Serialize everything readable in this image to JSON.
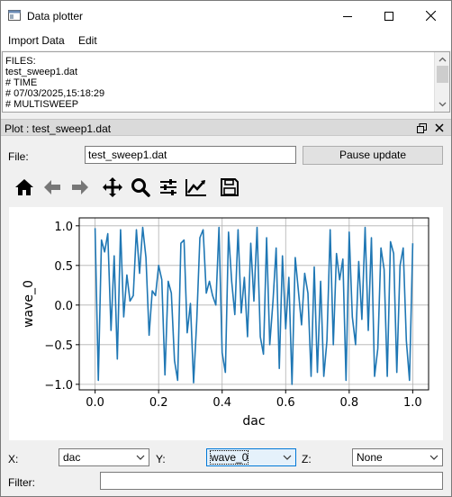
{
  "window": {
    "title": "Data plotter"
  },
  "menu": {
    "items": [
      "Import Data",
      "Edit"
    ]
  },
  "files_box": {
    "lines": [
      "FILES:",
      "test_sweep1.dat",
      "# TIME",
      "# 07/03/2025,15:18:29",
      "# MULTISWEEP"
    ]
  },
  "dock": {
    "title": "Plot : test_sweep1.dat"
  },
  "file_row": {
    "label": "File:",
    "value": "test_sweep1.dat",
    "pause_label": "Pause update"
  },
  "toolbar": {
    "icons": [
      "home-icon",
      "back-arrow-icon",
      "forward-arrow-icon",
      "pan-icon",
      "zoom-icon",
      "configure-subplots-icon",
      "edit-axis-icon",
      "save-icon"
    ]
  },
  "selectors": {
    "x_label": "X:",
    "x_value": "dac",
    "y_label": "Y:",
    "y_value": "wave_0",
    "z_label": "Z:",
    "z_value": "None",
    "filter_label": "Filter:",
    "filter_value": ""
  },
  "colors": {
    "line": "#1f77b4",
    "accent": "#0078d7"
  },
  "chart_data": {
    "type": "line",
    "xlabel": "dac",
    "ylabel": "wave_0",
    "xlim": [
      -0.05,
      1.05
    ],
    "ylim": [
      -1.07,
      1.1
    ],
    "xticks": [
      "0.0",
      "0.2",
      "0.4",
      "0.6",
      "0.8",
      "1.0"
    ],
    "yticks": [
      "1.0",
      "0.5",
      "0.0",
      "−0.5",
      "−1.0"
    ],
    "grid": true,
    "series": [
      {
        "x": [
          0.0,
          0.01,
          0.02,
          0.03,
          0.04,
          0.05,
          0.06,
          0.07,
          0.08,
          0.09,
          0.1,
          0.11,
          0.12,
          0.13,
          0.14,
          0.15,
          0.16,
          0.17,
          0.18,
          0.19,
          0.2,
          0.21,
          0.22,
          0.23,
          0.24,
          0.25,
          0.26,
          0.27,
          0.28,
          0.29,
          0.3,
          0.31,
          0.32,
          0.33,
          0.34,
          0.35,
          0.36,
          0.37,
          0.38,
          0.39,
          0.4,
          0.41,
          0.42,
          0.43,
          0.44,
          0.45,
          0.46,
          0.47,
          0.48,
          0.49,
          0.5,
          0.51,
          0.52,
          0.53,
          0.54,
          0.55,
          0.56,
          0.57,
          0.58,
          0.59,
          0.6,
          0.61,
          0.62,
          0.63,
          0.64,
          0.65,
          0.66,
          0.67,
          0.68,
          0.69,
          0.7,
          0.71,
          0.72,
          0.73,
          0.74,
          0.75,
          0.76,
          0.77,
          0.78,
          0.79,
          0.8,
          0.81,
          0.82,
          0.83,
          0.84,
          0.85,
          0.86,
          0.87,
          0.88,
          0.89,
          0.9,
          0.91,
          0.92,
          0.93,
          0.94,
          0.95,
          0.96,
          0.97,
          0.98,
          0.99,
          1.0
        ],
        "y": [
          0.97,
          -0.95,
          0.82,
          0.67,
          0.9,
          -0.32,
          0.62,
          -0.68,
          0.95,
          -0.15,
          0.38,
          0.05,
          0.12,
          0.95,
          0.4,
          0.98,
          0.6,
          -0.38,
          0.18,
          0.12,
          0.5,
          0.32,
          -0.88,
          0.3,
          0.15,
          -0.7,
          -0.95,
          0.78,
          0.82,
          -0.35,
          0.02,
          -0.98,
          -0.2,
          0.85,
          0.95,
          0.15,
          0.3,
          0.12,
          0.0,
          0.98,
          -0.6,
          -0.85,
          0.92,
          0.3,
          -0.12,
          0.95,
          -0.1,
          0.35,
          -0.4,
          0.78,
          0.05,
          0.98,
          -0.4,
          -0.62,
          0.85,
          -0.5,
          0.05,
          0.72,
          -0.8,
          0.62,
          -0.3,
          0.35,
          -1.0,
          0.6,
          0.18,
          -0.25,
          0.4,
          0.15,
          -0.9,
          0.48,
          -0.85,
          0.3,
          -0.9,
          -0.45,
          0.95,
          -0.5,
          0.65,
          0.32,
          0.58,
          -0.95,
          0.92,
          -0.15,
          -0.5,
          0.55,
          -0.18,
          0.98,
          -0.32,
          0.85,
          -0.9,
          -0.55,
          0.72,
          0.45,
          -0.9,
          0.8,
          0.65,
          -0.85,
          0.5,
          0.72,
          -0.45,
          -0.95,
          0.78
        ]
      }
    ]
  }
}
